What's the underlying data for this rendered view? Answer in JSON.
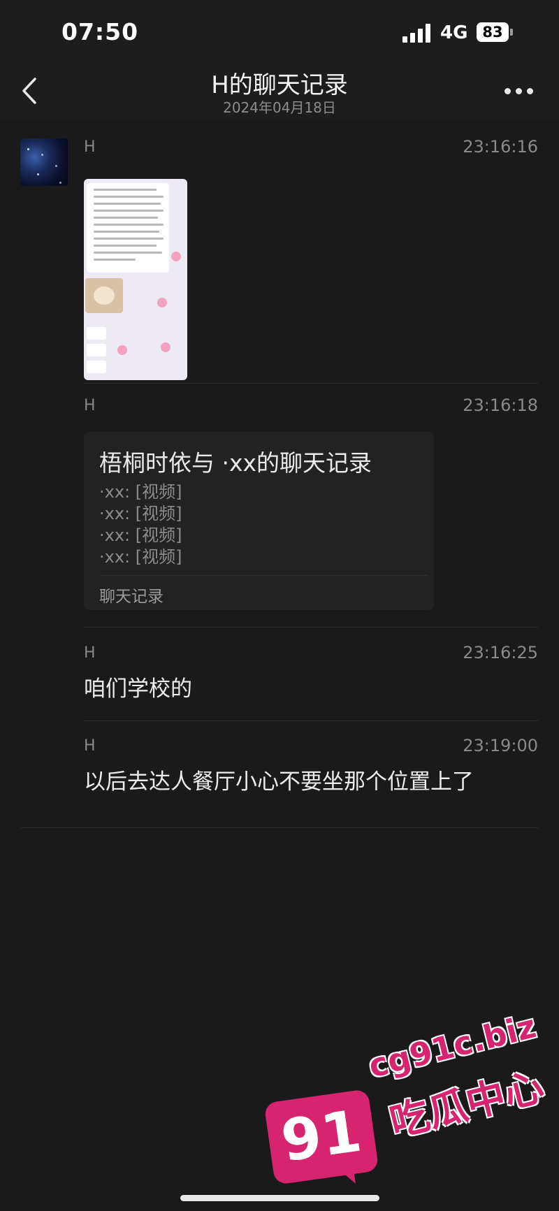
{
  "status_bar": {
    "time": "07:50",
    "network": "4G",
    "battery": "83"
  },
  "nav": {
    "title": "H的聊天记录",
    "subtitle": "2024年04月18日",
    "back_icon": "chevron-left-icon",
    "more_icon": "more-dots-icon"
  },
  "messages": [
    {
      "sender": "H",
      "time": "23:16:16",
      "kind": "image"
    },
    {
      "sender": "H",
      "time": "23:16:18",
      "kind": "chat-record",
      "card": {
        "title": "梧桐时依与 ·xx的聊天记录",
        "lines": [
          "·xx: [视频]",
          "·xx: [视频]",
          "·xx: [视频]",
          "·xx: [视频]"
        ],
        "footer": "聊天记录"
      }
    },
    {
      "sender": "H",
      "time": "23:16:25",
      "kind": "text",
      "text": "咱们学校的"
    },
    {
      "sender": "H",
      "time": "23:19:00",
      "kind": "text",
      "text": "以后去达人餐厅小心不要坐那个位置上了"
    }
  ],
  "watermark": {
    "domain": "cg91c.biz",
    "name": "吃瓜中心",
    "badge": "91"
  },
  "colors": {
    "background": "#1a1a1a",
    "watermark": "#d6246e"
  }
}
